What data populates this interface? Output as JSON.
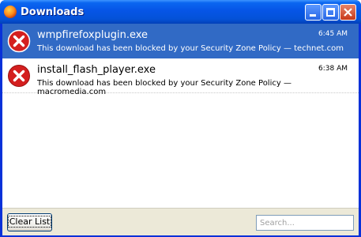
{
  "window": {
    "title": "Downloads",
    "app_icon": "firefox-icon",
    "controls": [
      "minimize",
      "maximize",
      "close"
    ]
  },
  "downloads": [
    {
      "filename": "wmpfirefoxplugin.exe",
      "time": "6:45 AM",
      "status": "This download has been blocked by your Security Zone Policy — technet.com",
      "icon": "error-icon",
      "selected": true
    },
    {
      "filename": "install_flash_player.exe",
      "time": "6:38 AM",
      "status": "This download has been blocked by your Security Zone Policy — macromedia.com",
      "icon": "error-icon",
      "selected": false
    }
  ],
  "footer": {
    "clear_label": "Clear List",
    "search_placeholder": "Search..."
  },
  "colors": {
    "selection": "#316ac5",
    "titlebar": "#0a5fe8",
    "error_red": "#d41f1f"
  }
}
